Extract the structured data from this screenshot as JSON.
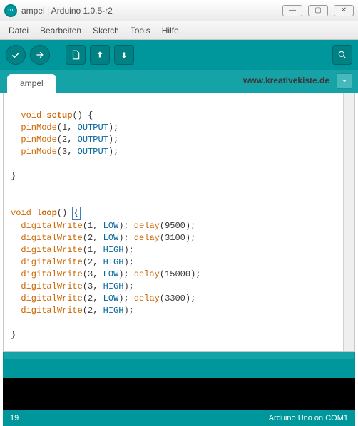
{
  "window": {
    "title": "ampel | Arduino 1.0.5-r2",
    "min": "—",
    "max": "▢",
    "close": "✕"
  },
  "menu": {
    "items": [
      "Datei",
      "Bearbeiten",
      "Sketch",
      "Tools",
      "Hilfe"
    ]
  },
  "toolbar": {
    "verify": "verify",
    "upload": "upload",
    "new": "new",
    "open": "open",
    "save": "save",
    "serial": "serial-monitor"
  },
  "tabs": {
    "active": "ampel",
    "url": "www.kreativekiste.de"
  },
  "code": {
    "tokens": [
      [
        "type",
        "void"
      ],
      [
        "txt",
        " "
      ],
      [
        "name",
        "setup"
      ],
      [
        "txt",
        "() {\n  "
      ],
      [
        "func",
        "pinMode"
      ],
      [
        "txt",
        "(1, "
      ],
      [
        "const",
        "OUTPUT"
      ],
      [
        "txt",
        ");\n  "
      ],
      [
        "func",
        "pinMode"
      ],
      [
        "txt",
        "(2, "
      ],
      [
        "const",
        "OUTPUT"
      ],
      [
        "txt",
        ");\n  "
      ],
      [
        "func",
        "pinMode"
      ],
      [
        "txt",
        "(3, "
      ],
      [
        "const",
        "OUTPUT"
      ],
      [
        "txt",
        ");\n\n}\n\n\n"
      ],
      [
        "type",
        "void"
      ],
      [
        "txt",
        " "
      ],
      [
        "name",
        "loop"
      ],
      [
        "txt",
        "() "
      ],
      [
        "cur",
        "{"
      ],
      [
        "txt",
        "\n  "
      ],
      [
        "func",
        "digitalWrite"
      ],
      [
        "txt",
        "(1, "
      ],
      [
        "const",
        "LOW"
      ],
      [
        "txt",
        "); "
      ],
      [
        "func",
        "delay"
      ],
      [
        "txt",
        "(9500);\n  "
      ],
      [
        "func",
        "digitalWrite"
      ],
      [
        "txt",
        "(2, "
      ],
      [
        "const",
        "LOW"
      ],
      [
        "txt",
        "); "
      ],
      [
        "func",
        "delay"
      ],
      [
        "txt",
        "(3100);\n  "
      ],
      [
        "func",
        "digitalWrite"
      ],
      [
        "txt",
        "(1, "
      ],
      [
        "const",
        "HIGH"
      ],
      [
        "txt",
        ");\n  "
      ],
      [
        "func",
        "digitalWrite"
      ],
      [
        "txt",
        "(2, "
      ],
      [
        "const",
        "HIGH"
      ],
      [
        "txt",
        ");  \n  "
      ],
      [
        "func",
        "digitalWrite"
      ],
      [
        "txt",
        "(3, "
      ],
      [
        "const",
        "LOW"
      ],
      [
        "txt",
        "); "
      ],
      [
        "func",
        "delay"
      ],
      [
        "txt",
        "(15000);\n  "
      ],
      [
        "func",
        "digitalWrite"
      ],
      [
        "txt",
        "(3, "
      ],
      [
        "const",
        "HIGH"
      ],
      [
        "txt",
        ");\n  "
      ],
      [
        "func",
        "digitalWrite"
      ],
      [
        "txt",
        "(2, "
      ],
      [
        "const",
        "LOW"
      ],
      [
        "txt",
        "); "
      ],
      [
        "func",
        "delay"
      ],
      [
        "txt",
        "(3300);\n  "
      ],
      [
        "func",
        "digitalWrite"
      ],
      [
        "txt",
        "(2, "
      ],
      [
        "const",
        "HIGH"
      ],
      [
        "txt",
        ");\n\n}\n"
      ]
    ]
  },
  "status": {
    "line": "19",
    "board": "Arduino Uno on COM1"
  }
}
